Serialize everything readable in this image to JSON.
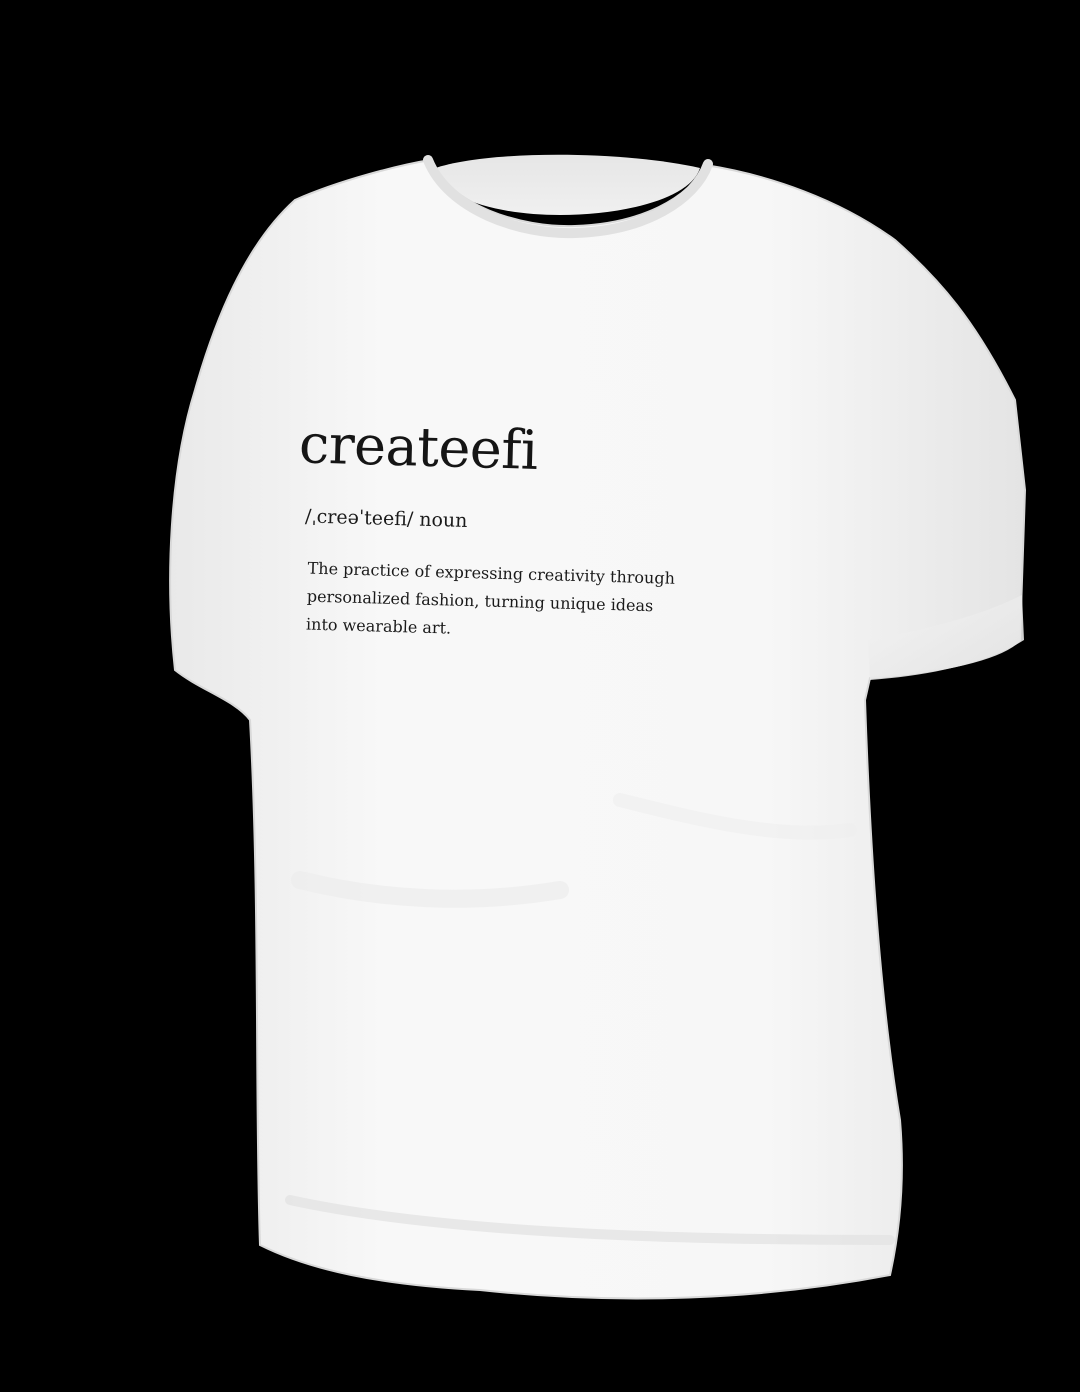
{
  "background": "#000000",
  "shirt": {
    "color": "#f7f7f7",
    "shadow": "#dcdcdc"
  },
  "print": {
    "word": "createefi",
    "pronunciation": "/ˌcreəˈteefi/",
    "part_of_speech": "noun",
    "definition_lines": [
      "The practice of expressing creativity through",
      "personalized fashion, turning unique ideas",
      "into wearable art."
    ]
  }
}
